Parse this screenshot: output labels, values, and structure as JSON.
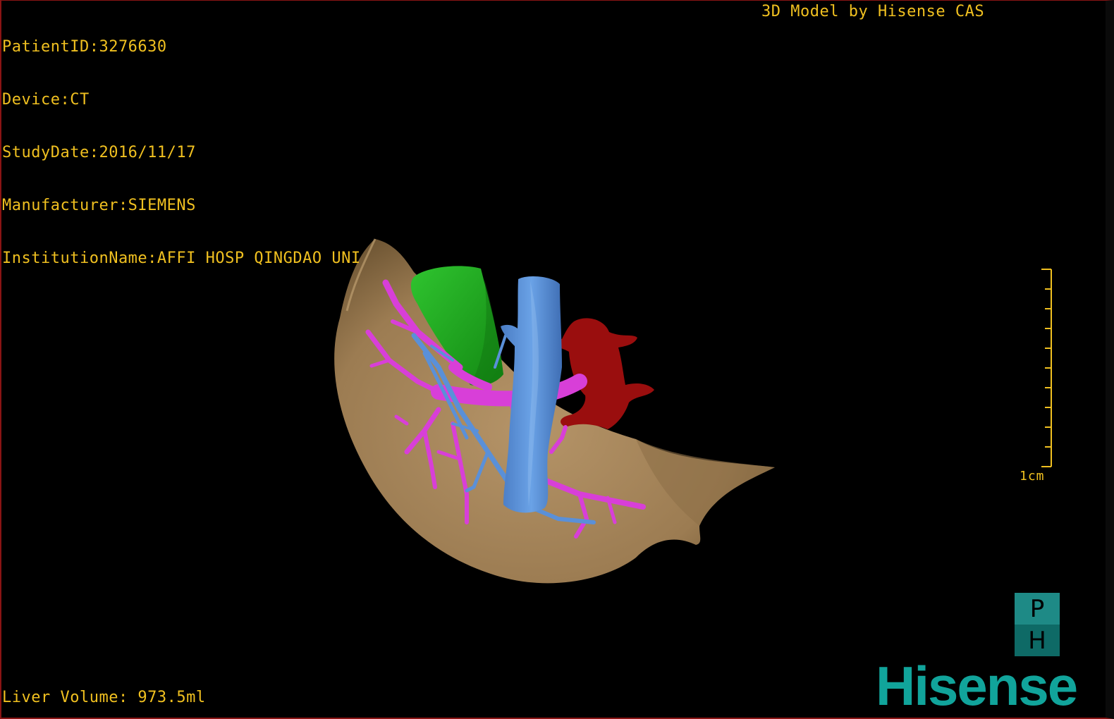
{
  "patient_info": {
    "patient_id": "PatientID:3276630",
    "device": "Device:CT",
    "study_date": "StudyDate:2016/11/17",
    "manufacturer": "Manufacturer:SIEMENS",
    "institution": "InstitutionName:AFFI HOSP QINGDAO UNI"
  },
  "model_credit": "3D Model by Hisense CAS",
  "liver_volume": "Liver Volume: 973.5ml",
  "scale_bar": {
    "label": "1cm",
    "tick_count": 10
  },
  "orientation_cube": {
    "top_letter": "P",
    "bottom_letter": "H"
  },
  "brand": "Hisense",
  "colors": {
    "overlay_text": "#f0c020",
    "liver": "#a88a5e",
    "portal_vein": "#d83fd8",
    "vena_cava": "#5a90d8",
    "gallbladder": "#22a822",
    "artery": "#9a0e0e",
    "brand": "#11a49b"
  }
}
